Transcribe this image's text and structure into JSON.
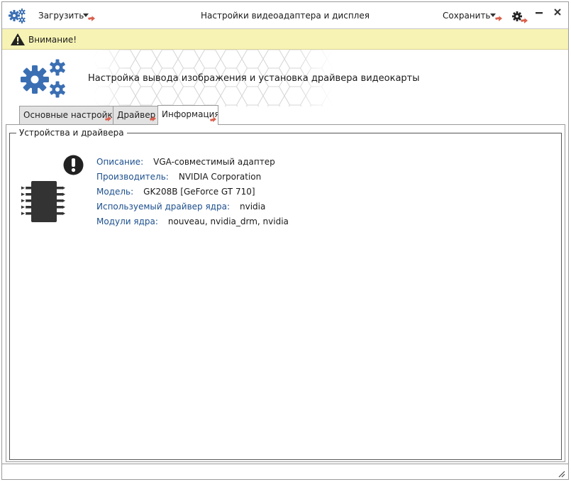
{
  "titlebar": {
    "load_label": "Загрузить",
    "title": "Настройки видеоадаптера и дисплея",
    "save_label": "Сохранить"
  },
  "warning": {
    "text": "Внимание!"
  },
  "header": {
    "title": "Настройка вывода изображения и установка драйвера видеокарты"
  },
  "tabs": [
    {
      "label": "Основные настройки",
      "active": false
    },
    {
      "label": "Драйвер",
      "active": false
    },
    {
      "label": "Информация",
      "active": true
    }
  ],
  "group": {
    "title": "Устройства и драйвера",
    "rows": [
      {
        "key": "Описание:",
        "value": "VGA-совместимый адаптер"
      },
      {
        "key": "Производитель:",
        "value": "NVIDIA Corporation"
      },
      {
        "key": "Модель:",
        "value": "GK208B [GeForce GT 710]"
      },
      {
        "key": "Используемый драйвер ядра:",
        "value": "nvidia"
      },
      {
        "key": "Модули ядра:",
        "value": "nouveau, nvidia_drm, nvidia"
      }
    ]
  },
  "colors": {
    "accent_blue": "#3b6fb3",
    "label_blue": "#1c4f8e",
    "warning_bg": "#f7f3b4",
    "marker_red": "#d9604d"
  },
  "icons": {
    "app": "gears-icon",
    "warning": "warning-triangle-icon",
    "settings": "gear-icon",
    "minimize": "minimize-icon",
    "close": "close-icon",
    "device": "chip-icon",
    "alert": "exclamation-circle-icon"
  }
}
